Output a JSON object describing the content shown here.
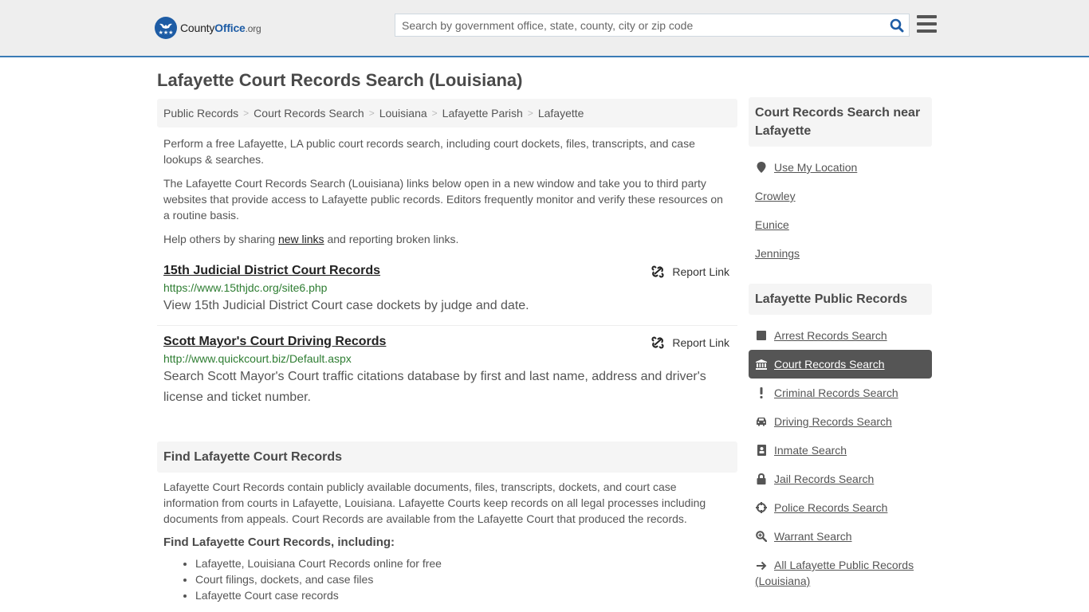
{
  "header": {
    "logo": {
      "county": "County",
      "office": "Office",
      "org": ".org"
    },
    "search": {
      "placeholder": "Search by government office, state, county, city or zip code",
      "value": ""
    },
    "icons": {
      "search": "search-icon",
      "menu": "menu-icon"
    },
    "accent_color": "#3a7bb5",
    "brand_color": "#1d5ca5"
  },
  "page": {
    "title": "Lafayette Court Records Search (Louisiana)"
  },
  "breadcrumb": [
    "Public Records",
    "Court Records Search",
    "Louisiana",
    "Lafayette Parish",
    "Lafayette"
  ],
  "intro": {
    "p1": "Perform a free Lafayette, LA public court records search, including court dockets, files, transcripts, and case lookups & searches.",
    "p2": "The Lafayette Court Records Search (Louisiana) links below open in a new window and take you to third party websites that provide access to Lafayette public records. Editors frequently monitor and verify these resources on a routine basis.",
    "p3_before": "Help others by sharing ",
    "p3_link": "new links",
    "p3_after": " and reporting broken links."
  },
  "results": [
    {
      "title": "15th Judicial District Court Records",
      "url": "https://www.15thjdc.org/site6.php",
      "description": "View 15th Judicial District Court case dockets by judge and date.",
      "report_label": "Report Link"
    },
    {
      "title": "Scott Mayor's Court Driving Records",
      "url": "http://www.quickcourt.biz/Default.aspx",
      "description": "Search Scott Mayor's Court traffic citations database by first and last name, address and driver's license and ticket number.",
      "report_label": "Report Link"
    }
  ],
  "find": {
    "heading": "Find Lafayette Court Records",
    "body": "Lafayette Court Records contain publicly available documents, files, transcripts, dockets, and court case information from courts in Lafayette, Louisiana. Lafayette Courts keep records on all legal processes including documents from appeals. Court Records are available from the Lafayette Court that produced the records.",
    "subheading": "Find Lafayette Court Records, including:",
    "list": [
      "Lafayette, Louisiana Court Records online for free",
      "Court filings, dockets, and case files",
      "Lafayette Court case records"
    ]
  },
  "sidebar": {
    "near": {
      "heading": "Court Records Search near Lafayette",
      "use_location": "Use My Location",
      "cities": [
        "Crowley",
        "Eunice",
        "Jennings"
      ]
    },
    "public_records": {
      "heading": "Lafayette Public Records",
      "items": [
        {
          "label": "Arrest Records Search",
          "icon": "square-icon",
          "active": false
        },
        {
          "label": "Court Records Search",
          "icon": "courthouse-icon",
          "active": true
        },
        {
          "label": "Criminal Records Search",
          "icon": "exclamation-icon",
          "active": false
        },
        {
          "label": "Driving Records Search",
          "icon": "car-icon",
          "active": false
        },
        {
          "label": "Inmate Search",
          "icon": "id-badge-icon",
          "active": false
        },
        {
          "label": "Jail Records Search",
          "icon": "lock-icon",
          "active": false
        },
        {
          "label": "Police Records Search",
          "icon": "crosshairs-icon",
          "active": false
        },
        {
          "label": "Warrant Search",
          "icon": "zoom-in-icon",
          "active": false
        }
      ],
      "all_link": "All Lafayette Public Records (Louisiana)"
    }
  }
}
